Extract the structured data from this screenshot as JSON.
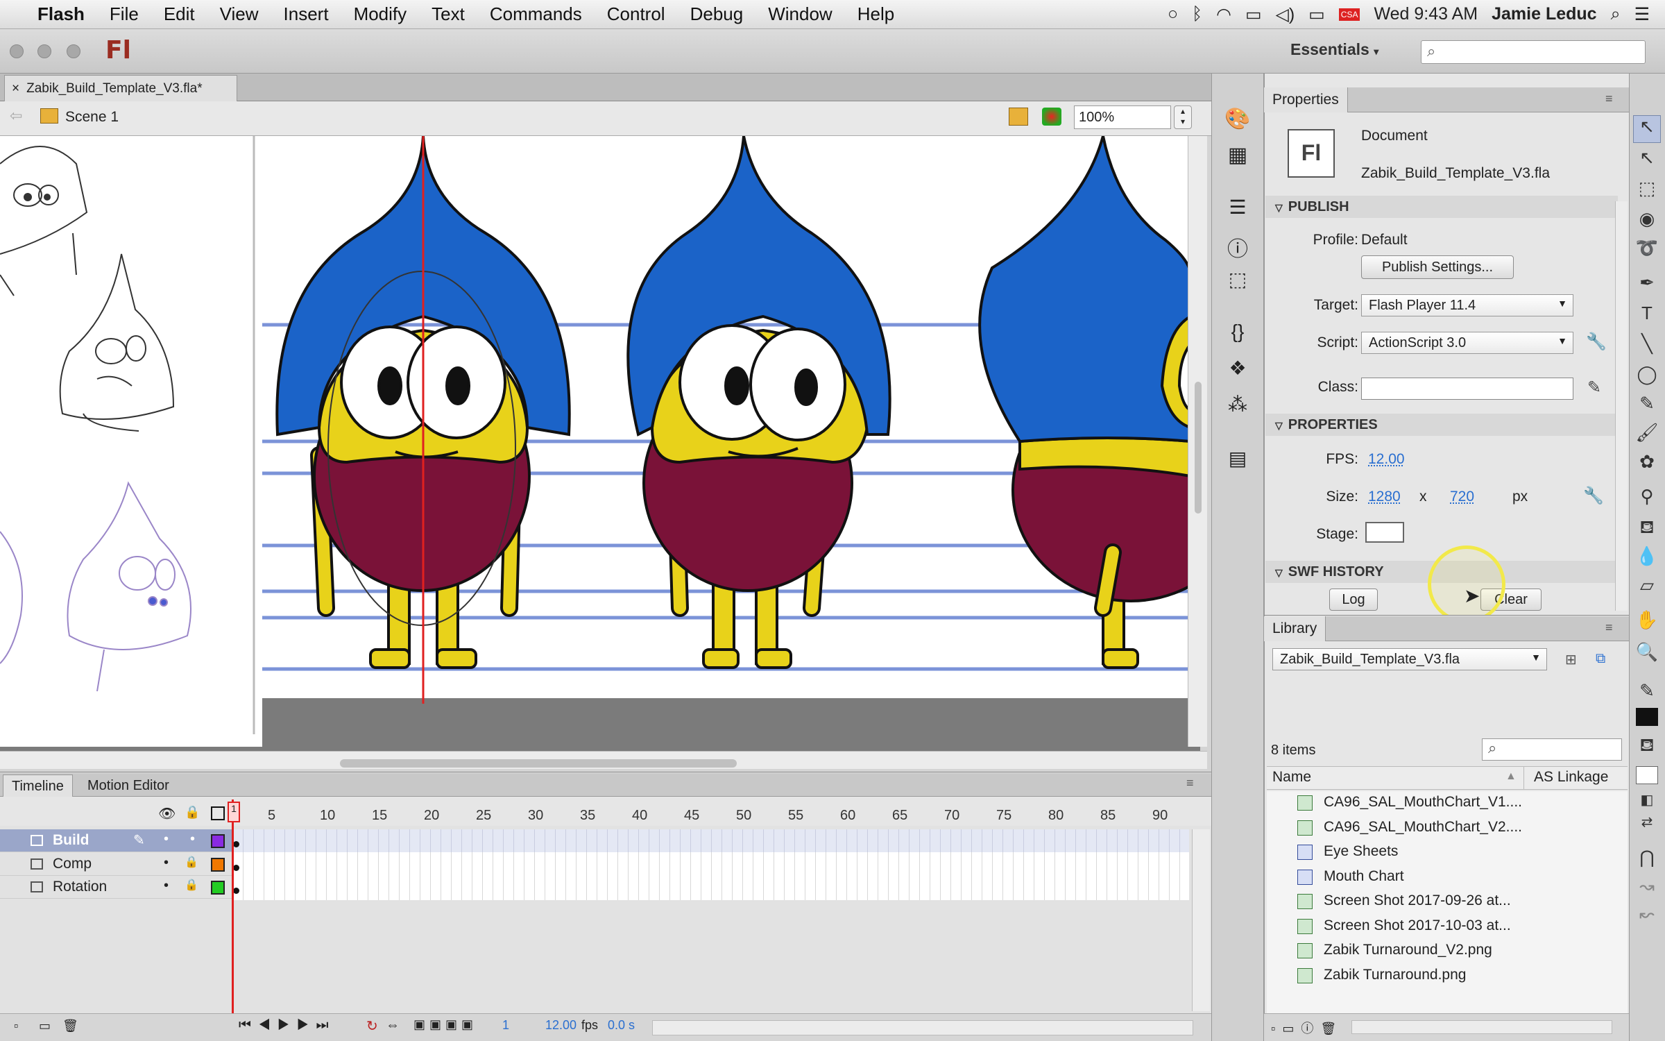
{
  "menubar": {
    "app": "Flash",
    "items": [
      "File",
      "Edit",
      "View",
      "Insert",
      "Modify",
      "Text",
      "Commands",
      "Control",
      "Debug",
      "Window",
      "Help"
    ],
    "clock": "Wed 9:43 AM",
    "user": "Jamie Leduc",
    "csa_badge": "CSA"
  },
  "app": {
    "logo": "Fl",
    "workspace": "Essentials",
    "doc_tab": "Zabik_Build_Template_V3.fla*",
    "scene": "Scene 1",
    "zoom": "100%"
  },
  "timeline": {
    "tabs": [
      "Timeline",
      "Motion Editor"
    ],
    "frame_numbers": [
      "1",
      "5",
      "10",
      "15",
      "20",
      "25",
      "30",
      "35",
      "40",
      "45",
      "50",
      "55",
      "60",
      "65",
      "70",
      "75",
      "80",
      "85",
      "90"
    ],
    "layers": [
      {
        "name": "Build",
        "color": "#8a2be2",
        "selected": true
      },
      {
        "name": "Comp",
        "color": "#f07800",
        "selected": false
      },
      {
        "name": "Rotation",
        "color": "#22cc22",
        "selected": false
      }
    ],
    "status": {
      "frame": "1",
      "fps": "12.00",
      "fps_unit": "fps",
      "time": "0.0 s"
    }
  },
  "properties": {
    "tab": "Properties",
    "doc_type": "Document",
    "doc_name": "Zabik_Build_Template_V3.fla",
    "fl_icon": "Fl",
    "publish": {
      "header": "PUBLISH",
      "profile_label": "Profile:",
      "profile_value": "Default",
      "settings_button": "Publish Settings...",
      "target_label": "Target:",
      "target_value": "Flash Player 11.4",
      "script_label": "Script:",
      "script_value": "ActionScript 3.0",
      "class_label": "Class:",
      "class_value": ""
    },
    "props": {
      "header": "PROPERTIES",
      "fps_label": "FPS:",
      "fps_value": "12.00",
      "size_label": "Size:",
      "width": "1280",
      "x": "x",
      "height": "720",
      "unit": "px",
      "stage_label": "Stage:",
      "stage_color": "#ffffff"
    },
    "swf": {
      "header": "SWF HISTORY",
      "log_button": "Log",
      "clear_button": "Clear"
    }
  },
  "library": {
    "tab": "Library",
    "file": "Zabik_Build_Template_V3.fla",
    "count": "8 items",
    "col_name": "Name",
    "col_linkage": "AS Linkage",
    "items": [
      {
        "name": "CA96_SAL_MouthChart_V1....",
        "type": "bitmap"
      },
      {
        "name": "CA96_SAL_MouthChart_V2....",
        "type": "bitmap"
      },
      {
        "name": "Eye Sheets",
        "type": "movieclip"
      },
      {
        "name": "Mouth Chart",
        "type": "movieclip"
      },
      {
        "name": "Screen Shot 2017-09-26 at...",
        "type": "bitmap"
      },
      {
        "name": "Screen Shot 2017-10-03 at...",
        "type": "bitmap"
      },
      {
        "name": "Zabik Turnaround_V2.png",
        "type": "bitmap"
      },
      {
        "name": "Zabik Turnaround.png",
        "type": "bitmap"
      }
    ]
  },
  "colors": {
    "hood": "#1b63c8",
    "body": "#e8d21a",
    "shorts": "#7a1238",
    "guide": "#7b93d8",
    "highlight": "#f2e94a"
  }
}
